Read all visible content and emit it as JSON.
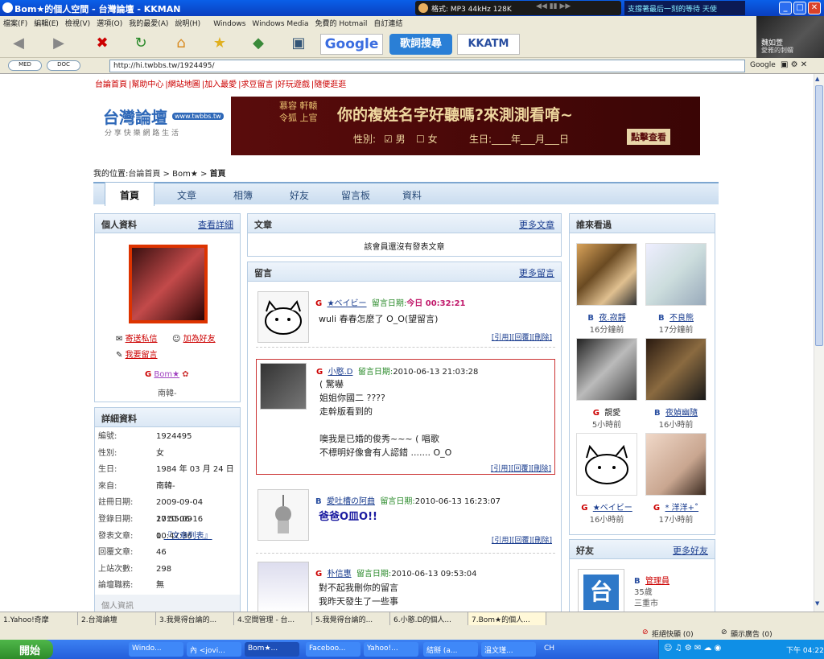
{
  "window": {
    "title": "Bom★的個人空間 - 台灣論壇 - KKMAN",
    "media_status": "格式: MP3 44kHz 128K",
    "ticker": "支撐著最后一刻的等待 天使"
  },
  "menu": [
    "檔案(F)",
    "編輯(E)",
    "檢視(V)",
    "選項(O)",
    "我的最愛(A)",
    "說明(H)",
    "Windows",
    "Windows Media",
    "免費的 Hotmail",
    "自訂連結"
  ],
  "toolbar": {
    "google": "Google",
    "lyrics": "歌詞搜尋",
    "kkatm": "KKATM"
  },
  "profile_overlay": {
    "line1": "魏如萱",
    "line2": "愛雅的刺蝟"
  },
  "address": {
    "url": "http://hi.twbbs.tw/1924495/",
    "search_engine": "Google",
    "mini1": "MED",
    "mini2": "DOC"
  },
  "site": {
    "top_links": [
      "台論首頁",
      "幫助中心",
      "網站地圖",
      "加入最愛",
      "求豆留言",
      "好玩遊戲",
      "隨便逛逛"
    ],
    "logo": {
      "title": "台灣論壇",
      "url": "www.twbbs.tw",
      "slogan": "分 享 快 樂 網 路 生 活"
    },
    "banner": {
      "side": "慕容 軒轅 令狐 上官",
      "headline": "你的複姓名字好聽嗎?來測測看唷~",
      "gender_label": "性別:",
      "male": "男",
      "female": "女",
      "birth": "生日:____年___月___日",
      "button": "點擊查看"
    },
    "breadcrumb": {
      "prefix": "我的位置:",
      "home": "台論首頁",
      "sep": " > ",
      "user": "Bom★",
      "current": "首頁"
    },
    "tabs": [
      "首頁",
      "文章",
      "相簿",
      "好友",
      "留言板",
      "資料"
    ]
  },
  "left": {
    "profile_head": "個人資料",
    "profile_more": "查看詳細",
    "send_msg": "寄送私信",
    "add_friend": "加為好友",
    "leave_msg": "我要留言",
    "user_letter": "G",
    "username": "Bom★",
    "location": "南韓-",
    "detail_head": "詳細資料",
    "details": [
      {
        "k": "編號:",
        "v": "1924495"
      },
      {
        "k": "性別:",
        "v": "女"
      },
      {
        "k": "生日:",
        "v": "1984 年 03 月 24 日"
      },
      {
        "k": "來自:",
        "v": "南韓-"
      },
      {
        "k": "註冊日期:",
        "v": "2009-09-04 17:55:09"
      },
      {
        "k": "登錄日期:",
        "v": "2010-06-16 10:47:36"
      },
      {
        "k": "發表文章:",
        "v": "0"
      },
      {
        "k": "回覆文章:",
        "v": "46"
      },
      {
        "k": "上站次數:",
        "v": "298"
      },
      {
        "k": "論壇職務:",
        "v": "無"
      }
    ],
    "article_list": "『文章列表』",
    "personal_info": "個人資訊"
  },
  "middle": {
    "articles_head": "文章",
    "articles_more": "更多文章",
    "no_articles": "該會員還沒有發表文章",
    "msgs_head": "留言",
    "msgs_more": "更多留言",
    "actions": [
      "[引用]",
      "[回覆]",
      "[刪除]"
    ],
    "messages": [
      {
        "letter": "G",
        "user": "★ベイビー",
        "date_label": "留言日期:",
        "date": "今日 00:32:21",
        "lines": [
          "wuli 春春怎麼了 O_O(望留言)"
        ]
      },
      {
        "letter": "G",
        "user": "小憨.D",
        "date_label": "留言日期:",
        "date": "2010-06-13 21:03:28",
        "lines": [
          "( 驚嚇",
          "姐姐你國二 ????",
          "走幹版看到的",
          "",
          "噢我是已婚的俊秀~~~ ( 唱歌",
          "不標明好像會有人認錯 ....... O_O"
        ]
      },
      {
        "letter": "B",
        "user": "愛吐槽の阿曲",
        "date_label": "留言日期:",
        "date": "2010-06-13 16:23:07",
        "lines": [
          "爸爸O皿O!!"
        ]
      },
      {
        "letter": "G",
        "user": "朴信惠",
        "date_label": "留言日期:",
        "date": "2010-06-13 09:53:04",
        "lines": [
          "對不起我刪你的留言",
          "我昨天發生了一些事"
        ]
      }
    ]
  },
  "right": {
    "visitors_head": "誰來看過",
    "visitors": [
      {
        "letter": "B",
        "name": "夜.寂靜",
        "time": "16分鐘前"
      },
      {
        "letter": "B",
        "name": "不良熊",
        "time": "17分鐘前"
      },
      {
        "letter": "G",
        "name": "靚愛",
        "time": "5小時前"
      },
      {
        "letter": "B",
        "name": "夜媜幽隨",
        "time": "16小時前"
      },
      {
        "letter": "G",
        "name": "★ベイビー",
        "time": "16小時前"
      },
      {
        "letter": "G",
        "name": "* 洋洋+˚",
        "time": "17小時前"
      }
    ],
    "friends_head": "好友",
    "friends_more": "更多好友",
    "friend": {
      "letter": "B",
      "name": "管理員",
      "age": "35歲",
      "city": "三重市"
    }
  },
  "browser_tabs": [
    "1.Yahoo!奇摩",
    "2.台灣論壇",
    "3.我覺得台論的...",
    "4.空間管理 - 台...",
    "5.我覺得台論的...",
    "6.小憨.D的個人...",
    "7.Bom★的個人..."
  ],
  "statusbar": {
    "popup": "拒絕快顯 (0)",
    "ads": "顯示廣告 (0)"
  },
  "taskbar": {
    "start": "開始",
    "tasks": [
      "Windo...",
      "內 <jovi...",
      "Bom★...",
      "Faceboo...",
      "Yahoo!...",
      "結掰 (a...",
      "溫文瑾..."
    ],
    "lang": "CH",
    "time": "下午 04:22"
  },
  "colors": {
    "accent": "#1a3d8f",
    "brand_red": "#cc0000",
    "panel_border": "#b7cde3"
  }
}
